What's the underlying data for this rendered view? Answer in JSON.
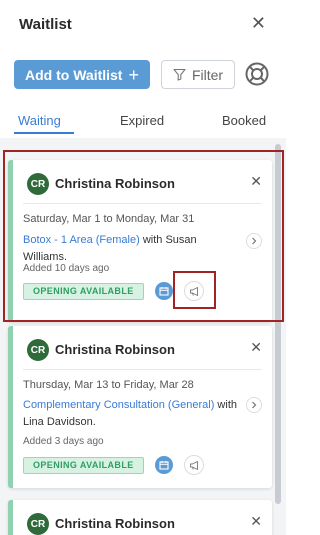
{
  "header": {
    "title": "Waitlist",
    "close_symbol": "✕"
  },
  "toolbar": {
    "add_label": "Add to Waitlist",
    "add_symbol": "+",
    "filter_label": "Filter"
  },
  "tabs": [
    {
      "label": "Waiting",
      "active": true
    },
    {
      "label": "Expired",
      "active": false
    },
    {
      "label": "Booked",
      "active": false
    }
  ],
  "cards": [
    {
      "initials": "CR",
      "name": "Christina Robinson",
      "close_symbol": "✕",
      "dates": "Saturday, Mar 1 to Monday, Mar 31",
      "service_link": "Botox - 1 Area (Female)",
      "service_rest": " with Susan Williams.",
      "added": "Added 10 days ago",
      "badge": "OPENING AVAILABLE"
    },
    {
      "initials": "CR",
      "name": "Christina Robinson",
      "close_symbol": "✕",
      "dates": "Thursday, Mar 13 to Friday, Mar 28",
      "service_link": "Complementary Consultation (General)",
      "service_rest": " with Lina Davidson.",
      "added": "Added 3 days ago",
      "badge": "OPENING AVAILABLE"
    },
    {
      "initials": "CR",
      "name": "Christina Robinson",
      "close_symbol": "✕"
    }
  ],
  "colors": {
    "primary": "#5b9bd5",
    "active_tab": "#3a7bd5",
    "card_accent": "#8fd1b0",
    "avatar": "#2f6b3a",
    "badge_text": "#2f9e63",
    "highlight": "#a02424"
  }
}
